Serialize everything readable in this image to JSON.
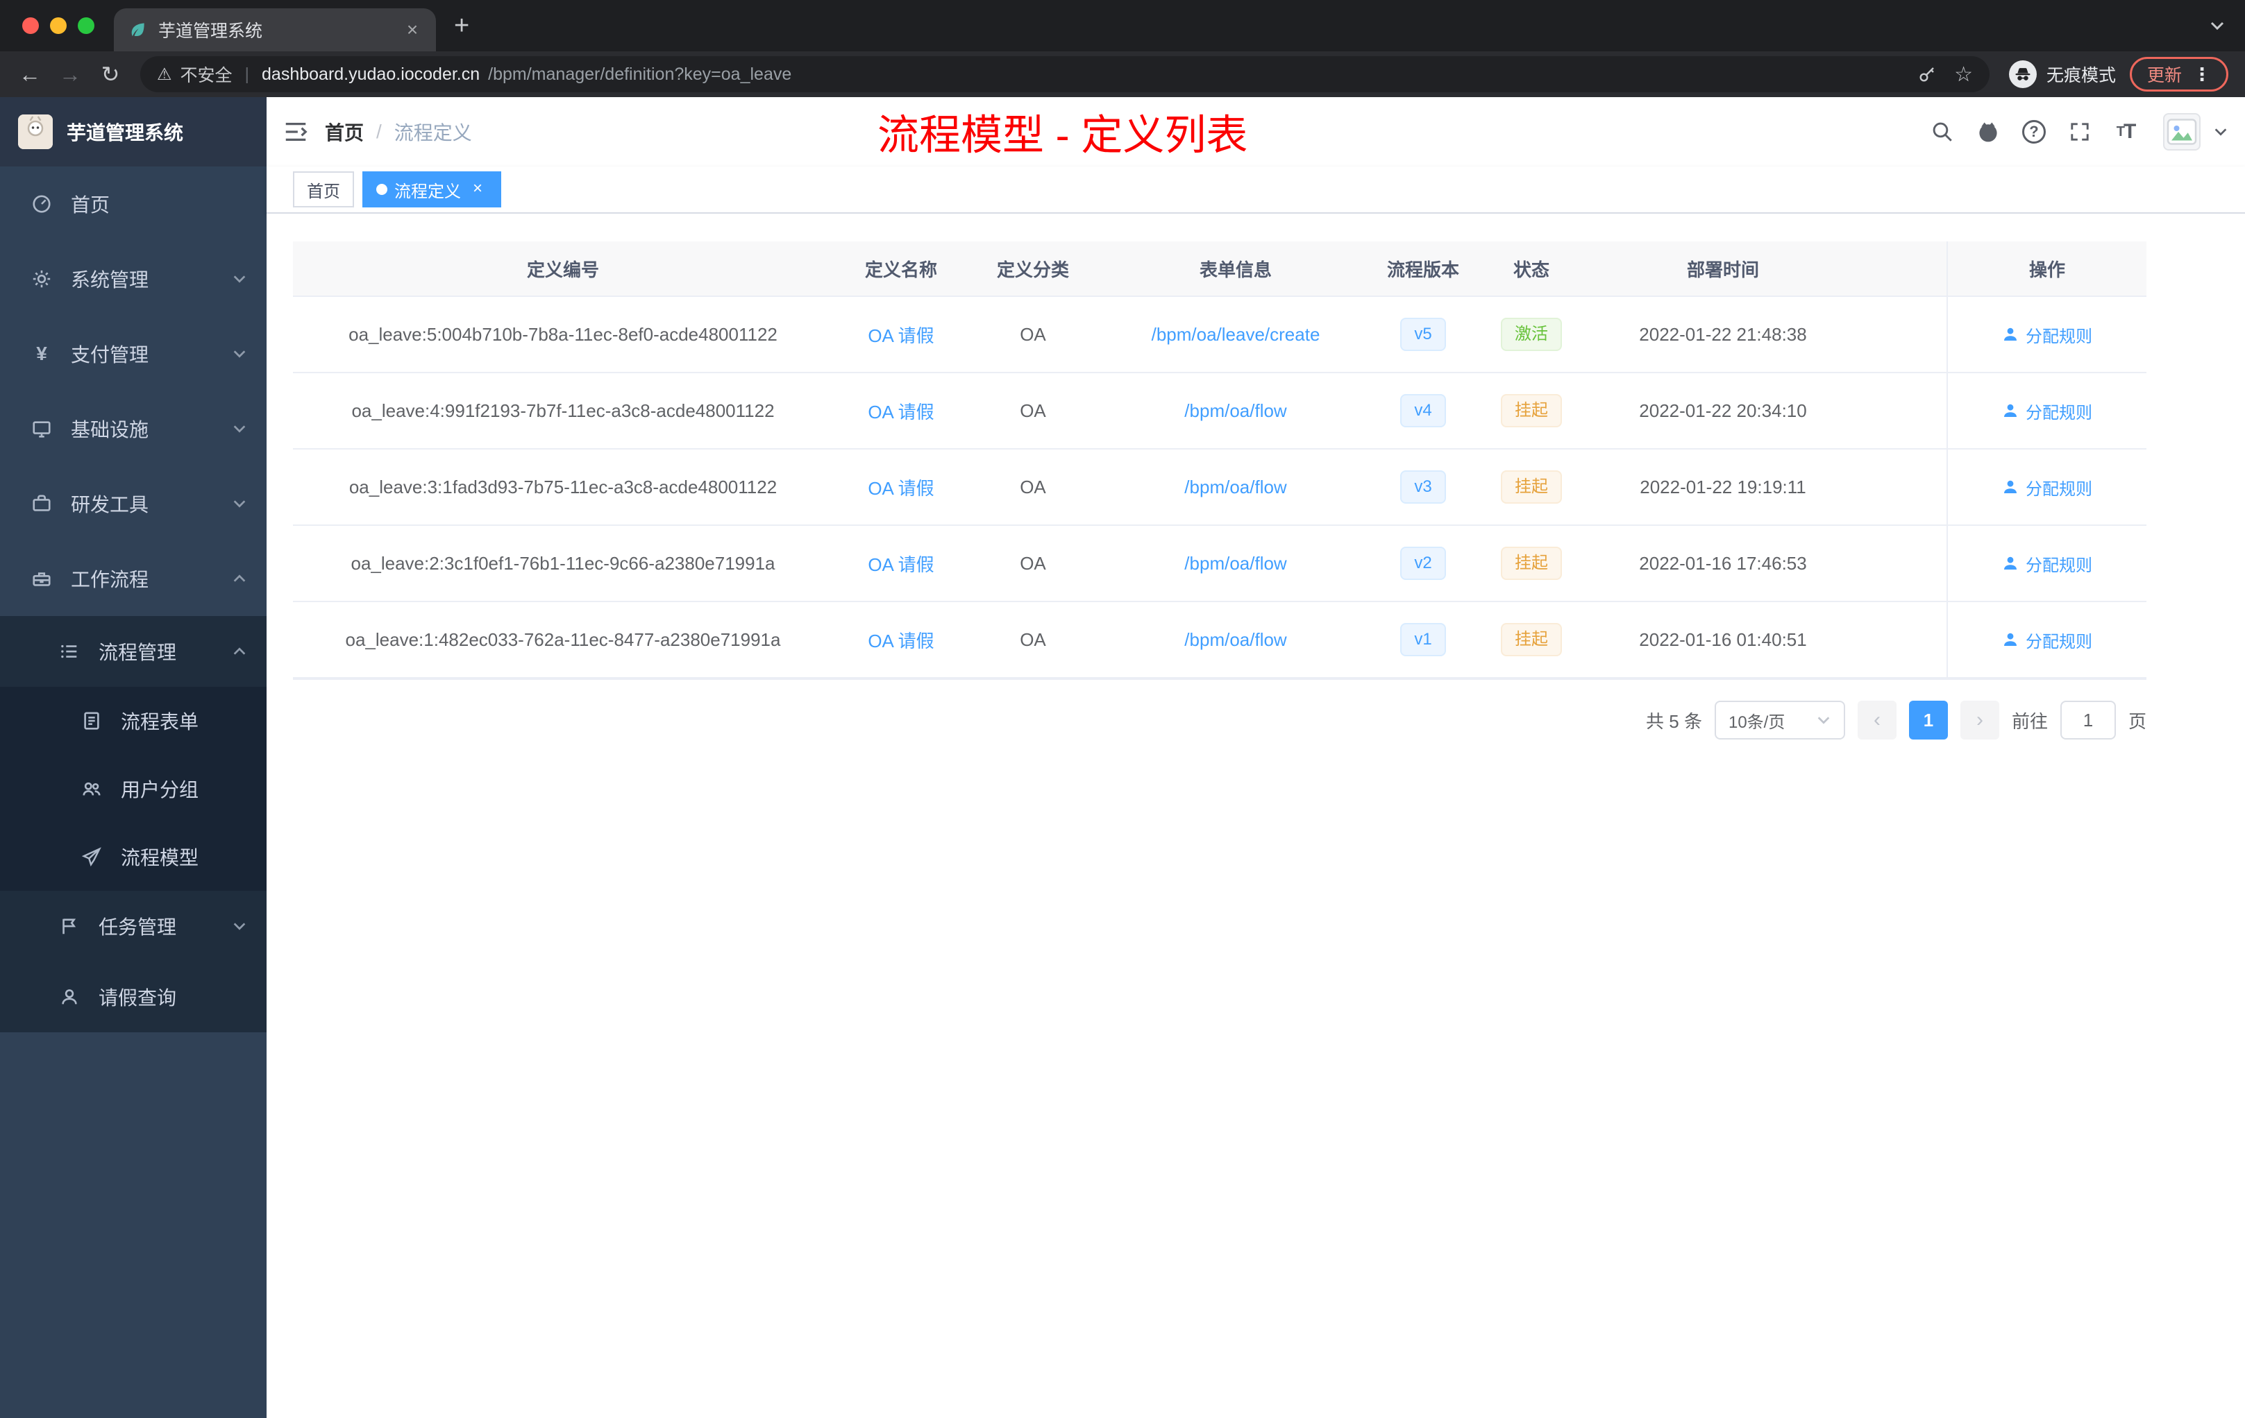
{
  "browser": {
    "tab_title": "芋道管理系统",
    "security_label": "不安全",
    "url_host": "dashboard.yudao.iocoder.cn",
    "url_path": "/bpm/manager/definition?key=oa_leave",
    "incognito_label": "无痕模式",
    "update_label": "更新"
  },
  "sidebar": {
    "logo_title": "芋道管理系统",
    "menu": [
      {
        "label": "首页"
      },
      {
        "label": "系统管理"
      },
      {
        "label": "支付管理"
      },
      {
        "label": "基础设施"
      },
      {
        "label": "研发工具"
      },
      {
        "label": "工作流程"
      },
      {
        "label": "流程管理"
      },
      {
        "label": "流程表单"
      },
      {
        "label": "用户分组"
      },
      {
        "label": "流程模型"
      },
      {
        "label": "任务管理"
      },
      {
        "label": "请假查询"
      }
    ]
  },
  "header": {
    "breadcrumb": {
      "home": "首页",
      "current": "流程定义"
    },
    "annotation": "流程模型 - 定义列表"
  },
  "tags": {
    "home": "首页",
    "active": "流程定义"
  },
  "table": {
    "columns": [
      "定义编号",
      "定义名称",
      "定义分类",
      "表单信息",
      "流程版本",
      "状态",
      "部署时间",
      "操作"
    ],
    "rows": [
      {
        "id": "oa_leave:5:004b710b-7b8a-11ec-8ef0-acde48001122",
        "name": "OA 请假",
        "category": "OA",
        "form": "/bpm/oa/leave/create",
        "version": "v5",
        "status": "激活",
        "status_type": "success",
        "deployed": "2022-01-22 21:48:38",
        "action": "分配规则"
      },
      {
        "id": "oa_leave:4:991f2193-7b7f-11ec-a3c8-acde48001122",
        "name": "OA 请假",
        "category": "OA",
        "form": "/bpm/oa/flow",
        "version": "v4",
        "status": "挂起",
        "status_type": "warning",
        "deployed": "2022-01-22 20:34:10",
        "action": "分配规则"
      },
      {
        "id": "oa_leave:3:1fad3d93-7b75-11ec-a3c8-acde48001122",
        "name": "OA 请假",
        "category": "OA",
        "form": "/bpm/oa/flow",
        "version": "v3",
        "status": "挂起",
        "status_type": "warning",
        "deployed": "2022-01-22 19:19:11",
        "action": "分配规则"
      },
      {
        "id": "oa_leave:2:3c1f0ef1-76b1-11ec-9c66-a2380e71991a",
        "name": "OA 请假",
        "category": "OA",
        "form": "/bpm/oa/flow",
        "version": "v2",
        "status": "挂起",
        "status_type": "warning",
        "deployed": "2022-01-16 17:46:53",
        "action": "分配规则"
      },
      {
        "id": "oa_leave:1:482ec033-762a-11ec-8477-a2380e71991a",
        "name": "OA 请假",
        "category": "OA",
        "form": "/bpm/oa/flow",
        "version": "v1",
        "status": "挂起",
        "status_type": "warning",
        "deployed": "2022-01-16 01:40:51",
        "action": "分配规则"
      }
    ]
  },
  "pagination": {
    "total": "共 5 条",
    "page_size": "10条/页",
    "current_page": "1",
    "goto_label": "前往",
    "goto_value": "1",
    "page_unit": "页"
  },
  "colors": {
    "accent": "#409eff",
    "success": "#67c23a",
    "warning": "#e6a23c",
    "annotation_red": "#fb0000",
    "sidebar_bg": "#304156"
  }
}
